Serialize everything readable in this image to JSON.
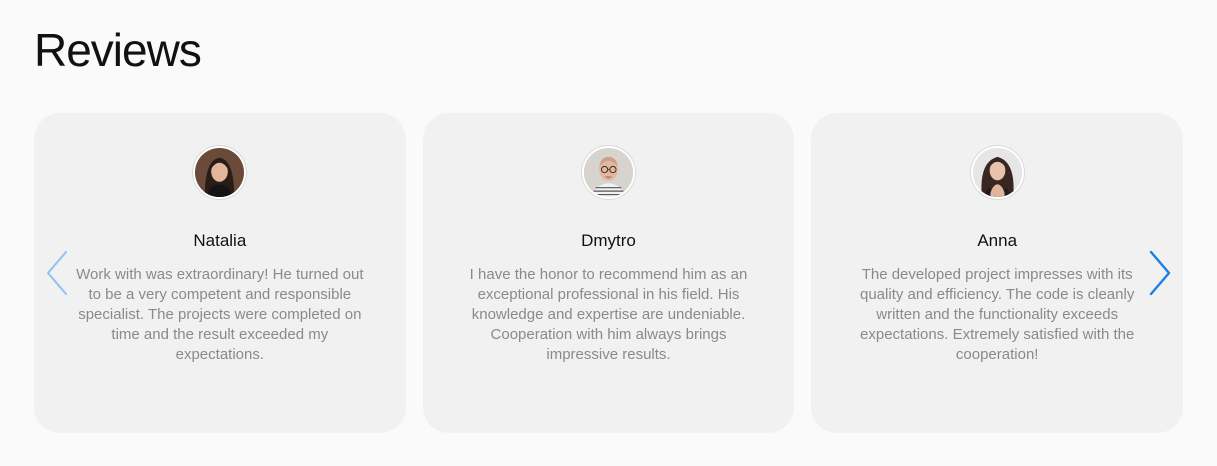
{
  "heading": "Reviews",
  "colors": {
    "background": "#fafafa",
    "card": "#f1f1f1",
    "text_muted": "#8a8a8a",
    "arrow_prev": "#8ec2f2",
    "arrow_next": "#1a7fe6"
  },
  "carousel": {
    "prev_icon": "chevron-left-icon",
    "next_icon": "chevron-right-icon"
  },
  "reviews": [
    {
      "name": "Natalia",
      "avatar": "woman-dark-hair-photo",
      "text": "Work with was extraordinary! He turned out to be a very competent and responsible specialist. The projects were completed on time and the result exceeded my expectations."
    },
    {
      "name": "Dmytro",
      "avatar": "man-glasses-photo",
      "text": "I have the honor to recommend him as an exceptional professional in his field. His knowledge and expertise are undeniable. Cooperation with him always brings impressive results."
    },
    {
      "name": "Anna",
      "avatar": "woman-curly-hair-photo",
      "text": "The developed project impresses with its quality and efficiency. The code is cleanly written and the functionality exceeds expectations. Extremely satisfied with the cooperation!"
    }
  ]
}
